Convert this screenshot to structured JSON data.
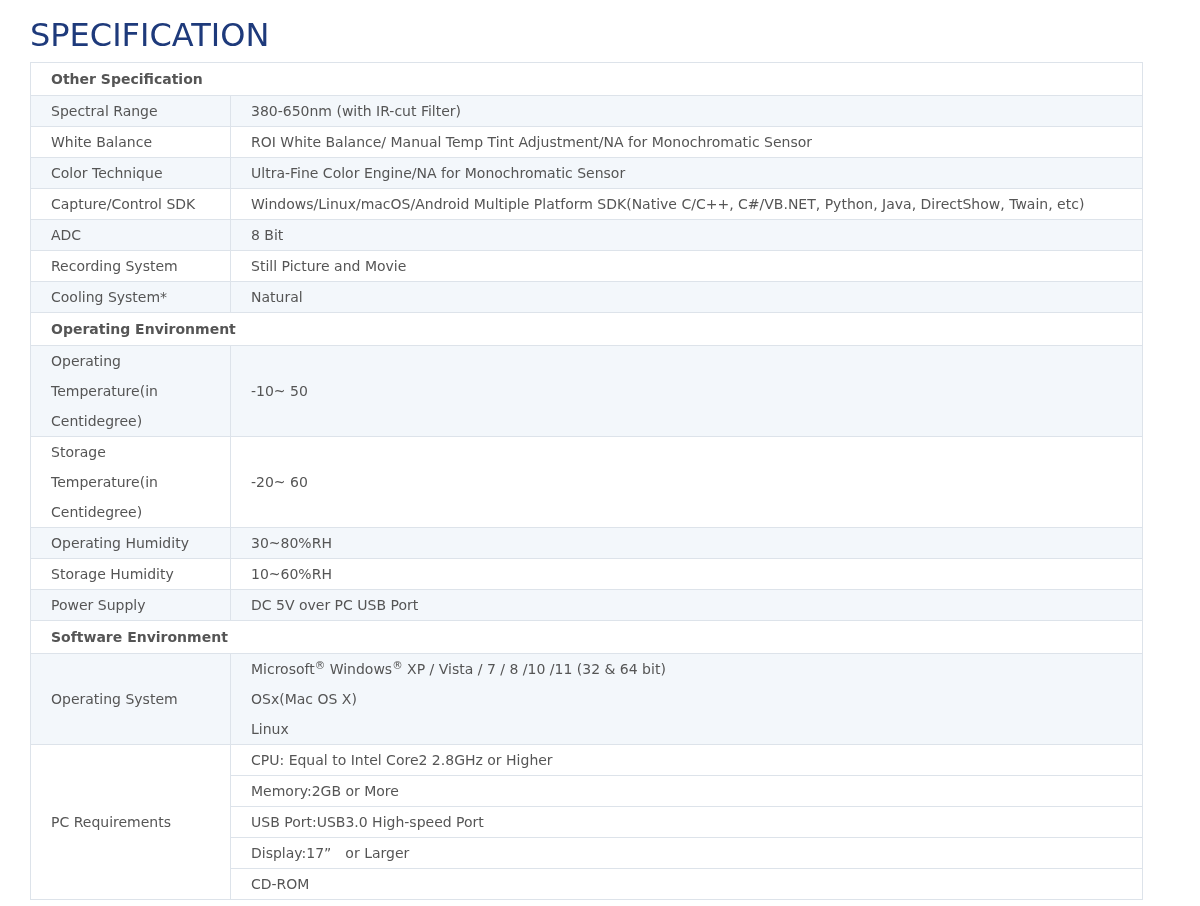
{
  "title": "SPECIFICATION",
  "sections": [
    {
      "heading": "Other Specification",
      "rows": [
        {
          "label": "Spectral Range",
          "kind": "lines",
          "values": [
            "380-650nm (with IR-cut Filter)"
          ]
        },
        {
          "label": "White Balance",
          "kind": "lines",
          "values": [
            "ROI White Balance/ Manual Temp Tint Adjustment/NA for Monochromatic Sensor"
          ]
        },
        {
          "label": "Color Technique",
          "kind": "lines",
          "values": [
            "Ultra-Fine Color Engine/NA for Monochromatic Sensor"
          ]
        },
        {
          "label": "Capture/Control SDK",
          "kind": "lines",
          "values": [
            "Windows/Linux/macOS/Android Multiple Platform SDK(Native C/C++, C#/VB.NET, Python, Java, DirectShow, Twain, etc)"
          ]
        },
        {
          "label": "ADC",
          "kind": "lines",
          "values": [
            "8 Bit"
          ]
        },
        {
          "label": "Recording System",
          "kind": "lines",
          "values": [
            "Still Picture and Movie"
          ]
        },
        {
          "label": "Cooling System*",
          "kind": "lines",
          "values": [
            "Natural"
          ]
        }
      ]
    },
    {
      "heading": "Operating Environment",
      "rows": [
        {
          "label": "Operating Temperature(in Centidegree)",
          "kind": "lines",
          "values": [
            "-10~ 50"
          ]
        },
        {
          "label": "Storage Temperature(in Centidegree)",
          "kind": "lines",
          "values": [
            "-20~ 60"
          ]
        },
        {
          "label": "Operating Humidity",
          "kind": "lines",
          "values": [
            "30~80%RH"
          ]
        },
        {
          "label": "Storage Humidity",
          "kind": "lines",
          "values": [
            "10~60%RH"
          ]
        },
        {
          "label": "Power Supply",
          "kind": "lines",
          "values": [
            "DC 5V over PC USB Port"
          ]
        }
      ]
    },
    {
      "heading": "Software Environment",
      "rows": [
        {
          "label": "Operating System",
          "kind": "lines",
          "values": [
            "Microsoft$^{®}$ Windows$^{®}$ XP / Vista / 7 / 8 /10 /11 (32 & 64 bit)",
            "OSx(Mac OS X)",
            "Linux"
          ]
        },
        {
          "label": "PC Requirements",
          "kind": "subrows",
          "values": [
            "CPU: Equal to Intel Core2 2.8GHz or Higher",
            "Memory:2GB or More",
            "USB Port:USB3.0 High-speed Port",
            "Display:17”　or Larger",
            "CD-ROM"
          ]
        }
      ]
    }
  ]
}
